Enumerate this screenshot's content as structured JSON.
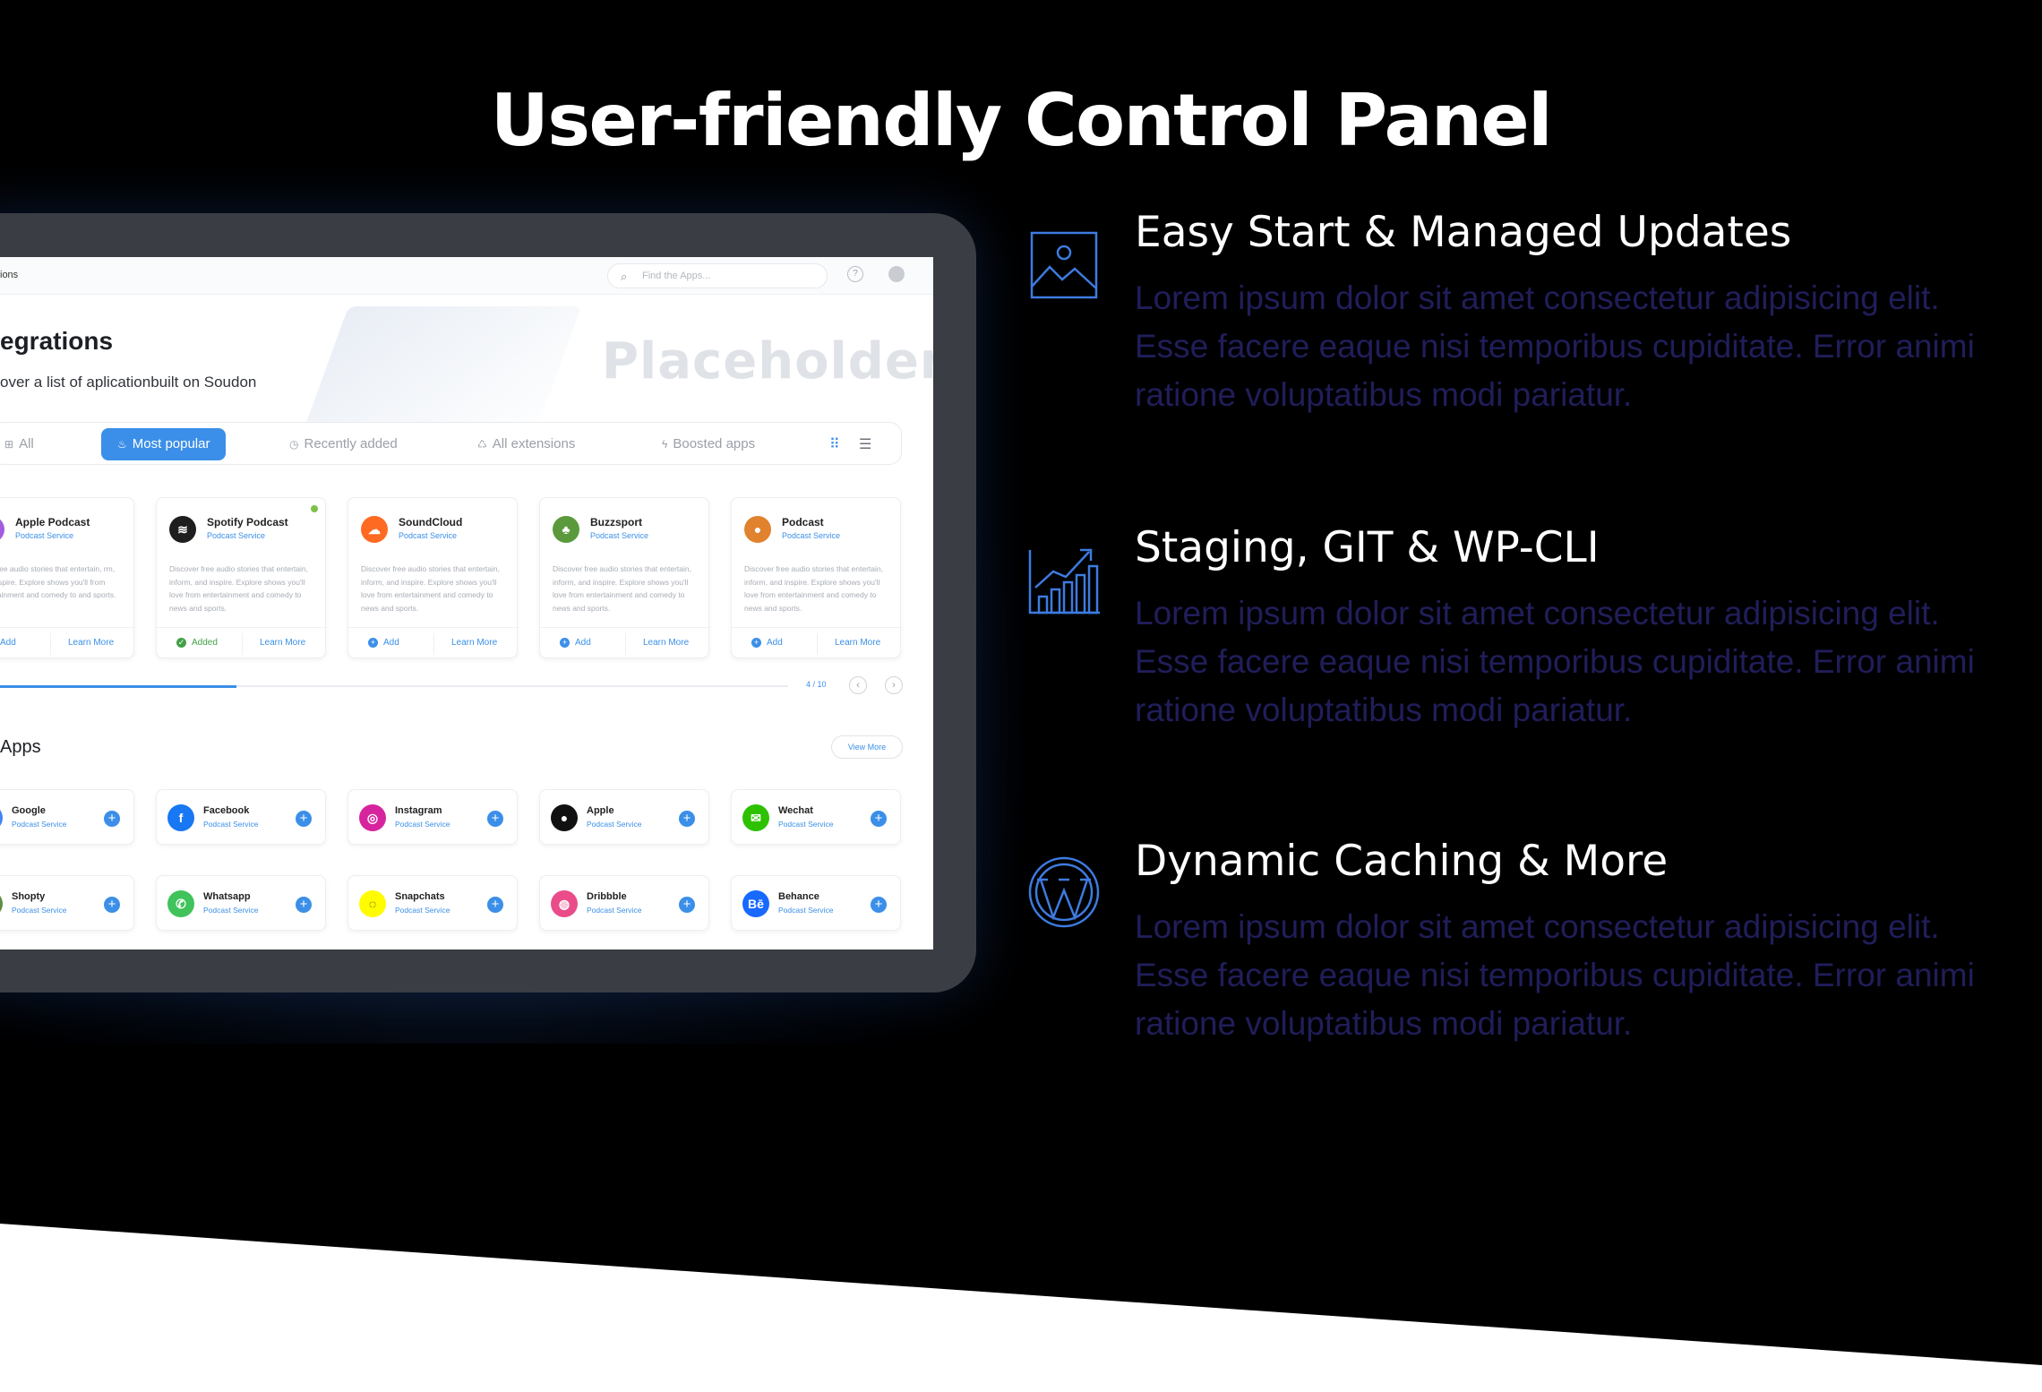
{
  "hero": {
    "title": "User-friendly Control Panel"
  },
  "app": {
    "breadcrumb": "ions",
    "search": {
      "placeholder": "Find the Apps...",
      "icon": "search-icon"
    },
    "help_glyph": "?",
    "heading": "egrations",
    "subtitle": "over a list of aplicationbuilt on Soudon",
    "watermark": "Placeholder",
    "tabs": [
      {
        "label": "All",
        "icon": "grid-icon",
        "active": false
      },
      {
        "label": "Most popular",
        "icon": "flame-icon",
        "active": true
      },
      {
        "label": "Recently added",
        "icon": "clock-icon",
        "active": false
      },
      {
        "label": "All extensions",
        "icon": "puzzle-icon",
        "active": false
      },
      {
        "label": "Boosted apps",
        "icon": "bolt-icon",
        "active": false
      }
    ],
    "featured": [
      {
        "name": "Apple Podcast",
        "type": "Podcast Service",
        "desc": "over free audio stories that entertain, rm, and inspire. Explore shows you'll from entertainment and comedy to and sports.",
        "action": "Add",
        "learn": "Learn More",
        "color": "#a35be0",
        "glyph": "◉",
        "added": false
      },
      {
        "name": "Spotify Podcast",
        "type": "Podcast Service",
        "desc": "Discover free audio stories that entertain, inform, and inspire. Explore shows you'll love from entertainment and comedy to news and sports.",
        "action": "Added",
        "learn": "Learn More",
        "color": "#1e1e1e",
        "glyph": "≋",
        "added": true
      },
      {
        "name": "SoundCloud",
        "type": "Podcast Service",
        "desc": "Discover free audio stories that entertain, inform, and inspire. Explore shows you'll love from entertainment and comedy to news and sports.",
        "action": "Add",
        "learn": "Learn More",
        "color": "#ff6a22",
        "glyph": "☁",
        "added": false
      },
      {
        "name": "Buzzsport",
        "type": "Podcast Service",
        "desc": "Discover free audio stories that entertain, inform, and inspire. Explore shows you'll love from entertainment and comedy to news and sports.",
        "action": "Add",
        "learn": "Learn More",
        "color": "#5a9a3c",
        "glyph": "♣",
        "added": false
      },
      {
        "name": "Podcast",
        "type": "Podcast Service",
        "desc": "Discover free audio stories that entertain, inform, and inspire. Explore shows you'll love from entertainment and comedy to news and sports.",
        "action": "Add",
        "learn": "Learn More",
        "color": "#e0822e",
        "glyph": "●",
        "added": false
      }
    ],
    "pager": "4 / 10",
    "slider_progress": 0.3,
    "apps_title": "Apps",
    "view_more": "View More",
    "apps": [
      {
        "name": "Google",
        "type": "Podcast Service",
        "color": "#4285f4",
        "glyph": "G"
      },
      {
        "name": "Facebook",
        "type": "Podcast Service",
        "color": "#1877f2",
        "glyph": "f"
      },
      {
        "name": "Instagram",
        "type": "Podcast Service",
        "color": "#d6249f",
        "glyph": "◎"
      },
      {
        "name": "Apple",
        "type": "Podcast Service",
        "color": "#111111",
        "glyph": "●"
      },
      {
        "name": "Wechat",
        "type": "Podcast Service",
        "color": "#2dc100",
        "glyph": "✉"
      },
      {
        "name": "Shopty",
        "type": "Podcast Service",
        "color": "#5e8e3e",
        "glyph": "S"
      },
      {
        "name": "Whatsapp",
        "type": "Podcast Service",
        "color": "#3fc35a",
        "glyph": "✆"
      },
      {
        "name": "Snapchats",
        "type": "Podcast Service",
        "color": "#fffc00",
        "glyph": "◌"
      },
      {
        "name": "Dribbble",
        "type": "Podcast Service",
        "color": "#ea4c89",
        "glyph": "◍"
      },
      {
        "name": "Behance",
        "type": "Podcast Service",
        "color": "#1769ff",
        "glyph": "Bē"
      }
    ]
  },
  "features": [
    {
      "title": "Easy Start & Managed Updates",
      "desc": "Lorem ipsum dolor sit amet consectetur adipisicing elit. Esse facere eaque nisi temporibus cupiditate. Error animi ratione voluptatibus modi pariatur.",
      "icon": "image-icon"
    },
    {
      "title": "Staging, GIT & WP-CLI",
      "desc": "Lorem ipsum dolor sit amet consectetur adipisicing elit. Esse facere eaque nisi temporibus cupiditate. Error animi ratione voluptatibus modi pariatur.",
      "icon": "growth-chart-icon"
    },
    {
      "title": "Dynamic Caching & More",
      "desc": "Lorem ipsum dolor sit amet consectetur adipisicing elit. Esse facere eaque nisi temporibus cupiditate. Error animi ratione voluptatibus modi pariatur.",
      "icon": "wordpress-icon"
    }
  ],
  "colors": {
    "accent": "#3b8fe8",
    "feature_text": "#201e5a",
    "icon_stroke": "#3d7be0"
  }
}
